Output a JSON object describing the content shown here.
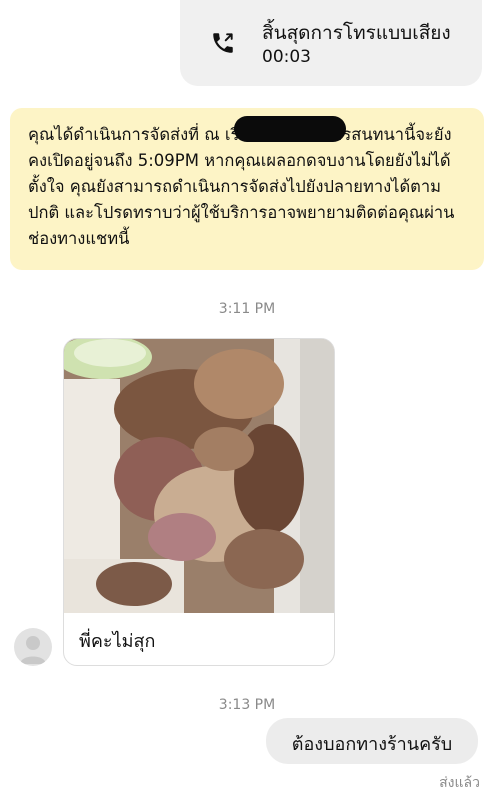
{
  "call": {
    "title": "สิ้นสุดการโทรแบบเสียง",
    "duration": "00:03",
    "icon": "phone-icon"
  },
  "system_message": {
    "text": "คุณได้ดำเนินการจัดส่งที่ ณ เรียบร้อยแล้ว การสนทนานี้จะยังคงเปิดอยู่จนถึง 5:09PM หากคุณเผลอกดจบงานโดยยังไม่ได้ตั้งใจ คุณยังสามารถดำเนินการจัดส่งไปยังปลายทางได้ตามปกติ และโปรดทราบว่าผู้ใช้บริการอาจพยายามติดต่อคุณผ่านช่องทางแชทนี้",
    "background": "#fdf4c6"
  },
  "messages": [
    {
      "time": "3:11 PM",
      "sender": "customer",
      "has_image": true,
      "text": "พี่คะไม่สุก"
    },
    {
      "time": "3:13 PM",
      "sender": "me",
      "text": "ต้องบอกทางร้านครับ",
      "status": "ส่งแล้ว"
    }
  ]
}
